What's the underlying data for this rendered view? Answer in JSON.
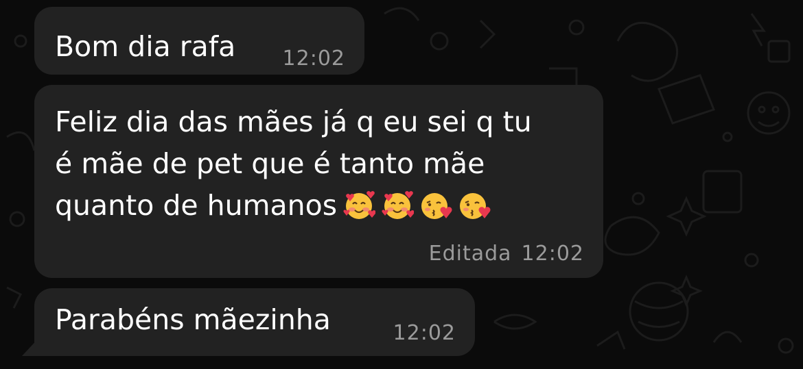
{
  "chat": {
    "messages": [
      {
        "text": "Bom dia rafa",
        "time": "12:02"
      },
      {
        "text_lines": [
          "Feliz dia das mães já q eu sei q tu",
          "é mãe de pet que é tanto mãe",
          "quanto de humanos"
        ],
        "emojis": [
          "smiling-face-with-hearts-icon",
          "smiling-face-with-hearts-icon",
          "face-blowing-kiss-icon",
          "face-blowing-kiss-icon"
        ],
        "edited_label": "Editada",
        "time": "12:02"
      },
      {
        "text": "Parabéns mãezinha",
        "time": "12:02"
      }
    ]
  },
  "colors": {
    "background": "#0b0b0b",
    "bubble": "#222222",
    "text": "#ffffff",
    "meta": "#9b9b9b"
  }
}
